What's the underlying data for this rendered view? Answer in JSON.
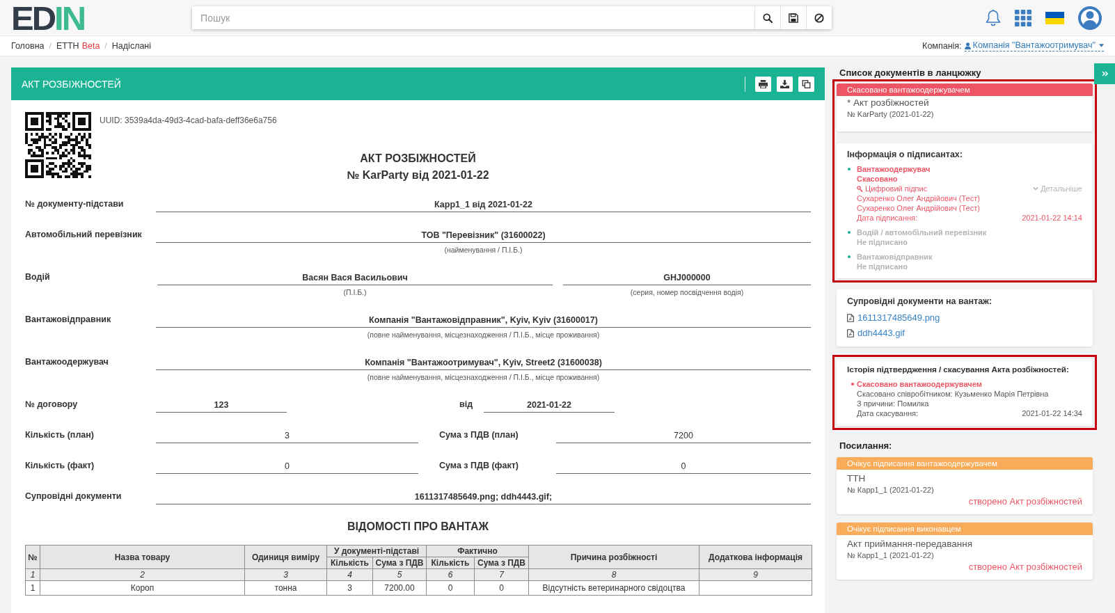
{
  "header": {
    "logo": {
      "part_1": "ED",
      "part_2": "IN"
    },
    "search": {
      "placeholder": "Пошук"
    }
  },
  "breadcrumb": [
    {
      "label": "Головна"
    },
    {
      "separator": "/",
      "label": "ЕТТН",
      "tag": "Beta"
    },
    {
      "separator": "/",
      "label": "Надіслані"
    }
  ],
  "company": {
    "label": "Компанія:",
    "value": "Компанія \"Вантажоотримувач\""
  },
  "document": {
    "header_title": "АКТ РОЗБІЖНОСТЕЙ",
    "uuid": "UUID: 3539a4da-49d3-4cad-bafa-deff36e6a756",
    "title": "АКТ РОЗБІЖНОСТЕЙ",
    "subtitle": "№ KarParty від 2021-01-22",
    "fields": [
      {
        "kind": "single",
        "label": "№ документу-підстави",
        "value": "Карр1_1 від 2021-01-22"
      },
      {
        "kind": "single",
        "label": "Автомобільний перевізник",
        "value": "ТОВ \"Перевізник\" (31600022)",
        "hint": "(найменування / П.І.Б.)"
      },
      {
        "kind": "driver",
        "label": "Водій",
        "value": "Васян Вася Васильович",
        "hint": "(П.І.Б.)",
        "value_2": "GHJ000000",
        "hint_2": "(серия, номер посвідчення водія)"
      },
      {
        "kind": "single",
        "label": "Вантажовідправник",
        "value": "Компанія \"Вантажовідправник\", Kyiv, Kyiv (31600017)",
        "hint": "(повне найменування, місцезнаходження / П.І.Б., місце проживання)"
      },
      {
        "kind": "single",
        "label": "Вантажоодержувач",
        "value": "Компанія \"Вантажоотримувач\", Kyiv, Street2 (31600038)",
        "hint": "(повне найменування, місцезнаходження / П.І.Б., місце проживання)"
      },
      {
        "kind": "contract",
        "label": "№ договору",
        "value": "123",
        "label_2": "від",
        "value_2": "2021-01-22"
      },
      {
        "kind": "amounts",
        "label": "Кількість (план)",
        "value": "3",
        "label_2": "Сума з ПДВ (план)",
        "value_2": "7200"
      },
      {
        "kind": "amounts",
        "label": "Кількість (факт)",
        "value": "0",
        "label_2": "Сума з ПДВ (факт)",
        "value_2": "0"
      },
      {
        "kind": "single",
        "label": "Супровідні документи",
        "value": "1611317485649.png; ddh4443.gif;"
      }
    ],
    "cargo": {
      "title": "ВІДОМОСТІ ПРО ВАНТАЖ",
      "header_rows": [
        [
          {
            "label": "№",
            "rowspan": 2
          },
          {
            "label": "Назва товару",
            "rowspan": 2
          },
          {
            "label": "Одиниця виміру",
            "rowspan": 2
          },
          {
            "label": "У документі-підставі",
            "colspan": 2
          },
          {
            "label": "Фактично",
            "colspan": 2
          },
          {
            "label": "Причина розбіжності",
            "rowspan": 2
          },
          {
            "label": "Додаткова інформація",
            "rowspan": 2
          }
        ],
        [
          {
            "label": "Кількість"
          },
          {
            "label": "Сума з ПДВ"
          },
          {
            "label": "Кількість"
          },
          {
            "label": "Сума з ПДВ"
          }
        ]
      ],
      "rows": [
        {
          "kind": "numbering",
          "cells": [
            "1",
            "2",
            "3",
            "4",
            "5",
            "6",
            "7",
            "8",
            "9"
          ]
        },
        {
          "kind": "item",
          "cells": [
            "1",
            "Короп",
            "тонна",
            "3",
            "7200.00",
            "0",
            "0",
            "Відсутність ветеринарного свідоцтва"
          ]
        }
      ]
    }
  },
  "sidebar": {
    "chain_title": "Список документів в ланцюжку",
    "chain": {
      "highlighted": true,
      "document": {
        "status": {
          "kind": "cancelled",
          "text": "Скасовано вантажоодержувачем"
        },
        "name": "* Акт розбіжностей",
        "number": "№ KarParty (2021-01-22)"
      },
      "signers": {
        "title": "Інформація о підписантах:",
        "items": [
          {
            "kind": "cancelled",
            "role": "Вантажоодержувач",
            "status": "Скасовано",
            "signature": "Цифровий підпис",
            "details": "Детальніше",
            "names": [
              "Сухаренко Олег Андрійович (Тест)",
              "Сухаренко Олег Андрійович (Тест)"
            ],
            "date_label": "Дата підписання:",
            "date": "2021-01-22 14:14"
          },
          {
            "kind": "pending",
            "role": "Водій / автомобільний перевізник",
            "status": "Не підписано"
          },
          {
            "kind": "pending",
            "role": "Вантажовідправник",
            "status": "Не підписано"
          }
        ]
      }
    },
    "attachments": {
      "title": "Супровідні документи на вантаж:",
      "files": [
        "1611317485649.png",
        "ddh4443.gif"
      ]
    },
    "history": {
      "highlighted": true,
      "title": "Історія підтвердження / скасування Акта розбіжностей:",
      "entries": [
        {
          "kind": "cancelled",
          "status": "Скасовано вантажоодержувачем",
          "lines": [
            "Скасовано співробітником: Кузьменко Марія Петрівна",
            "З причини: Помилка"
          ],
          "date_label": "Дата скасування:",
          "date": "2021-01-22 14:34"
        }
      ]
    },
    "links_title": "Посилання:",
    "links": [
      {
        "status": {
          "kind": "pending",
          "text": "Очікує підписання вантажоодержувачем"
        },
        "name": "ТТН",
        "number": "№ Карр1_1 (2021-01-22)",
        "relation": "створено Акт розбіжностей"
      },
      {
        "status": {
          "kind": "pending",
          "text": "Очікує підписання виконавцем"
        },
        "name": "Акт приймання-передавання",
        "number": "№ Карр1_1 (2021-01-22)",
        "relation": "створено Акт розбіжностей"
      }
    ]
  }
}
